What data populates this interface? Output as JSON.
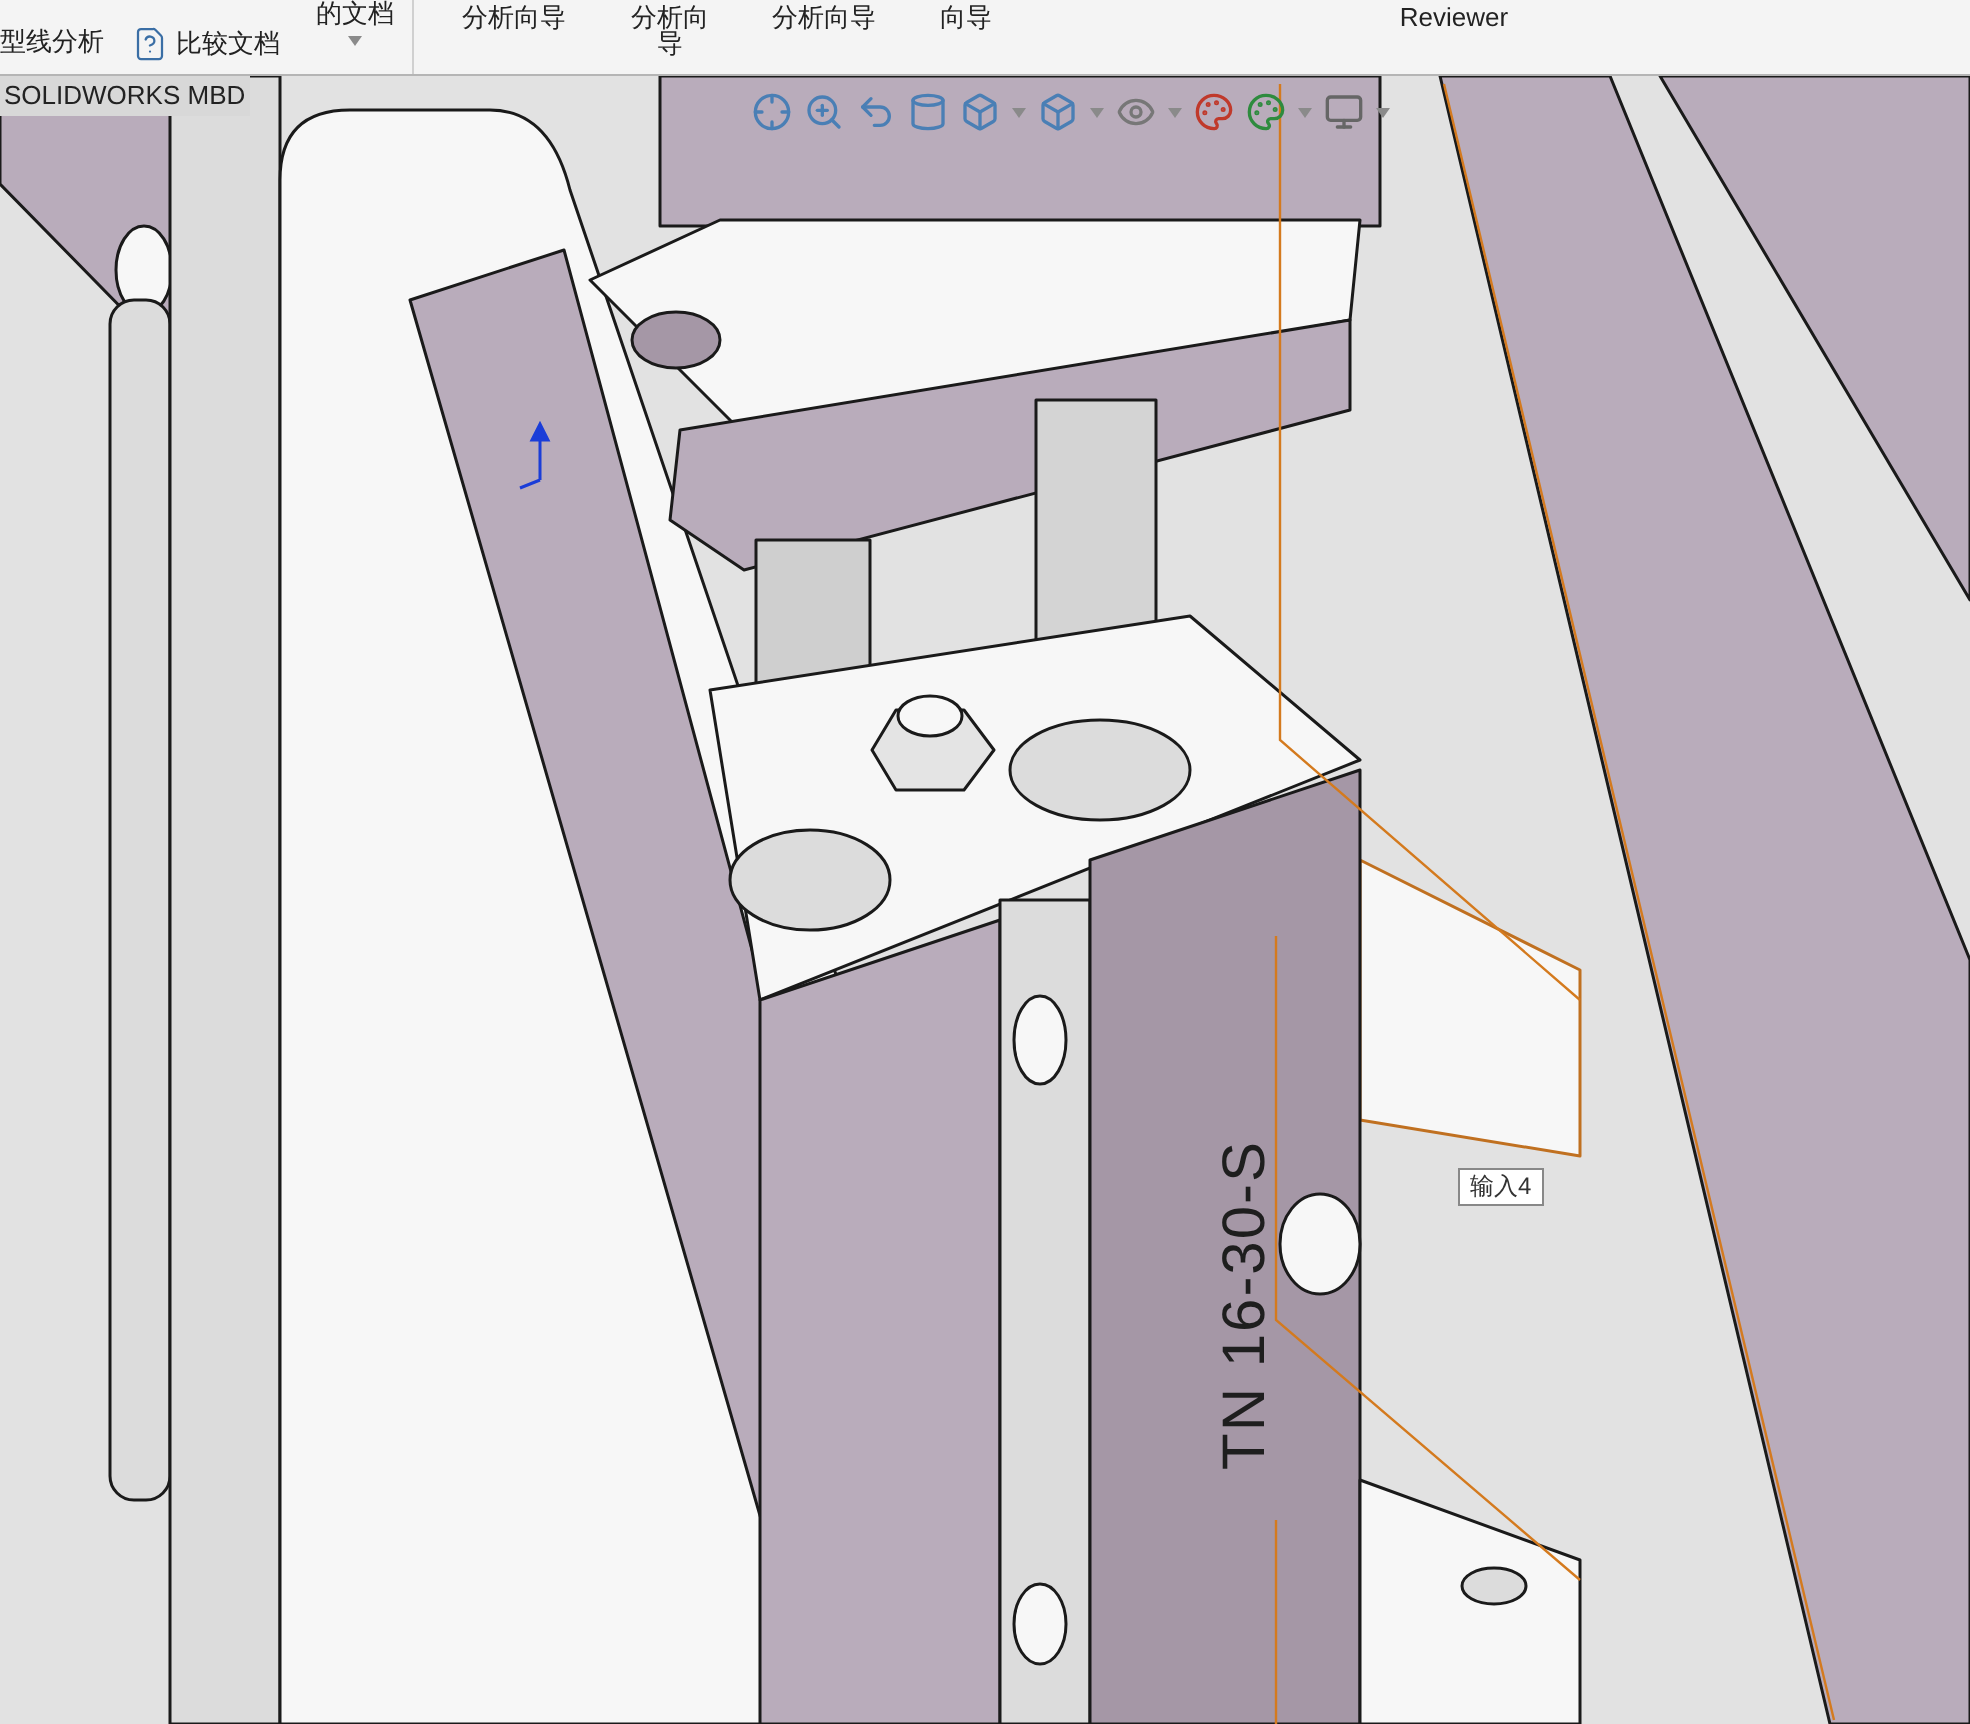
{
  "ribbon": {
    "left_commands": [
      {
        "label": "型线分析",
        "kind": "text"
      },
      {
        "label": "比较文档",
        "kind": "icon"
      }
    ],
    "menu": {
      "label": "的文档"
    },
    "wizards": [
      {
        "lines": [
          "分析向导"
        ]
      },
      {
        "lines": [
          "分析向",
          "导"
        ]
      },
      {
        "lines": [
          "分析向导"
        ]
      },
      {
        "lines": [
          "向导"
        ]
      },
      {
        "lines": [
          "Reviewer"
        ]
      }
    ]
  },
  "tabs": [
    {
      "label": "SOLIDWORKS MBD",
      "selected": true
    }
  ],
  "viewport": {
    "part_marking": "TN 16-30-S",
    "tooltip": "输入4"
  }
}
